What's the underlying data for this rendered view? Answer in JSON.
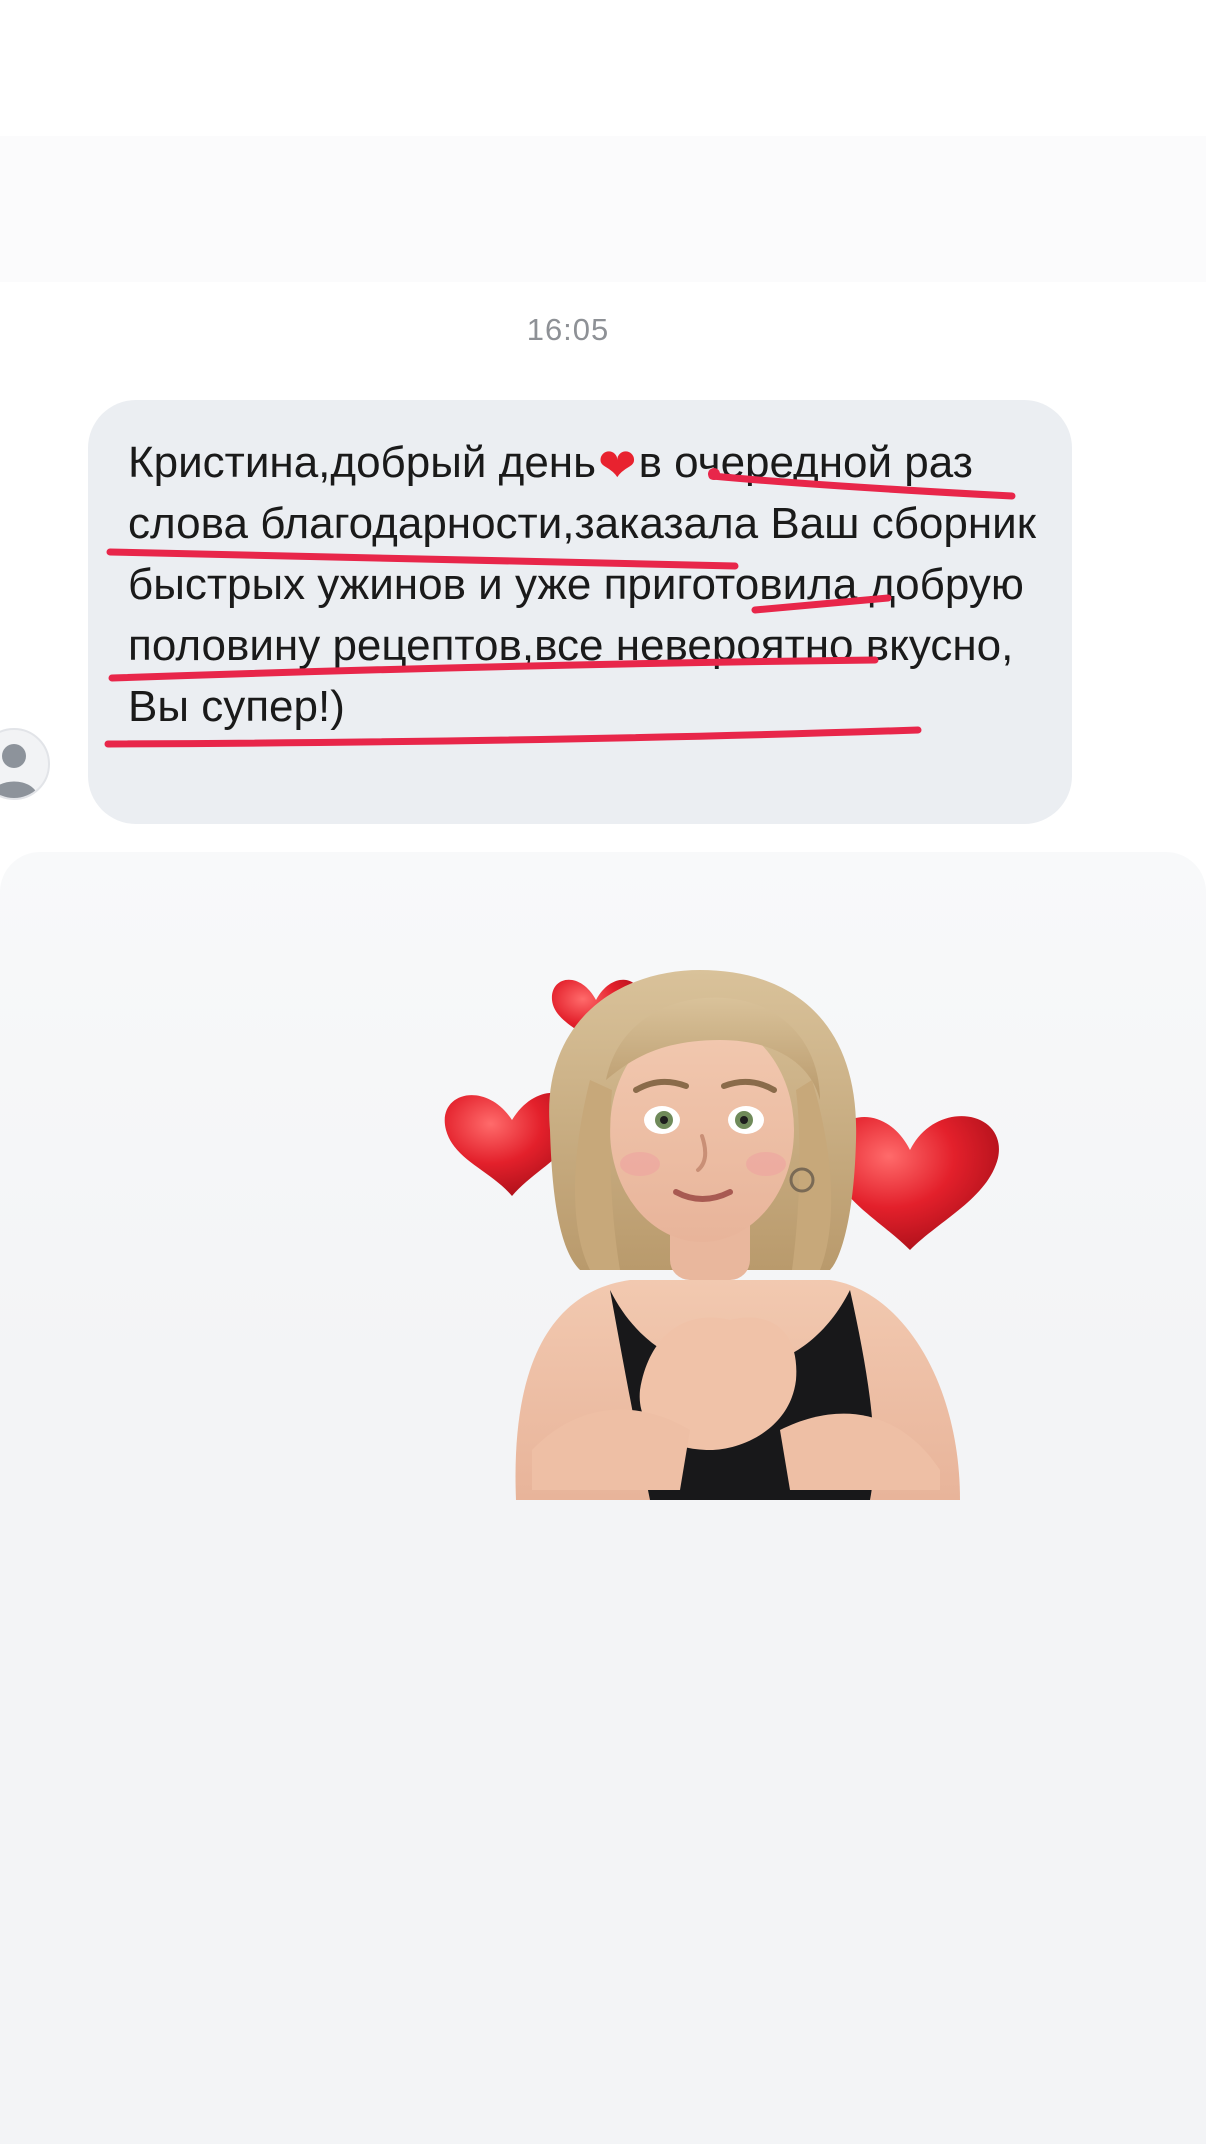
{
  "chat": {
    "timestamp": "16:05",
    "message": {
      "segments": [
        {
          "text": "Кристина,добрый день"
        },
        {
          "emoji": "heart-emoji",
          "char": "❤"
        },
        {
          "text": "в очередной раз слова благодарности,заказала Ваш сборник быстрых ужинов и уже приготовила добрую половину рецептов,все невероятно вкусно, Вы супер!)"
        }
      ]
    },
    "sender_avatar": "person-placeholder-icon",
    "sticker": {
      "icon": "cartoon-girl-hearts-sticker"
    }
  },
  "colors": {
    "bubble": "#ebeef2",
    "text": "#1a1a1a",
    "timestamp": "#8e9196",
    "underline": "#e8264a",
    "heart": "#e8222f"
  }
}
